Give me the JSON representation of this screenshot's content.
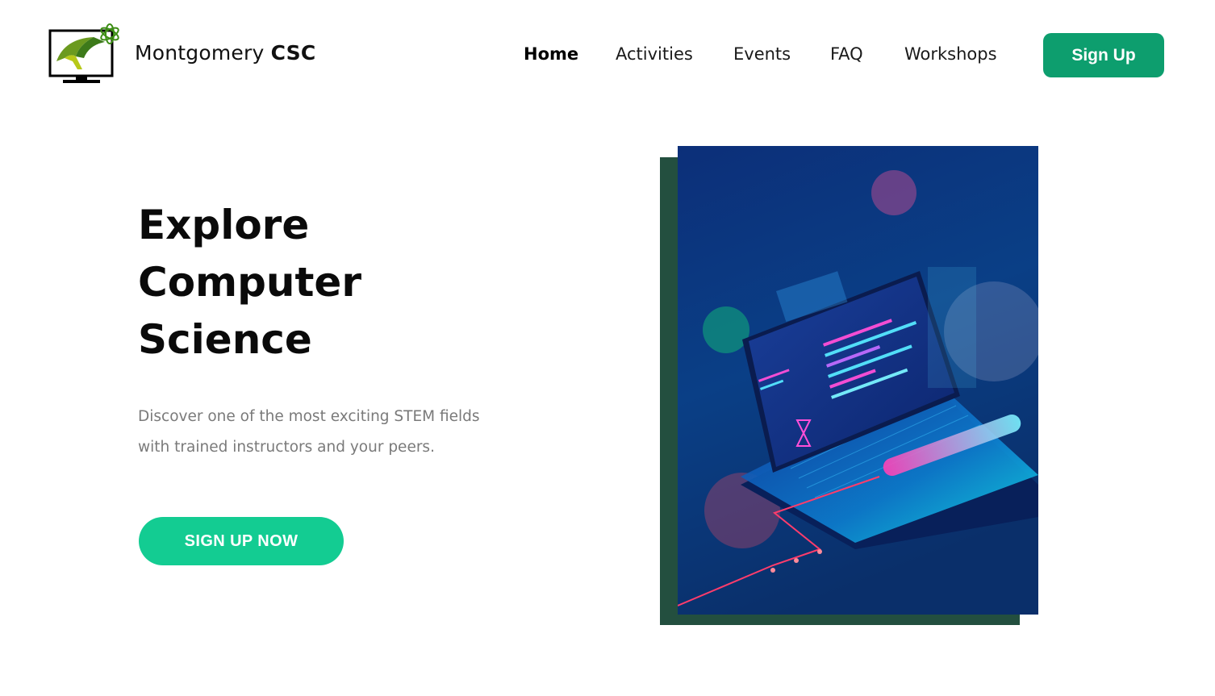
{
  "header": {
    "brand_prefix": "Montgomery ",
    "brand_strong": "CSC",
    "nav": [
      "Home",
      "Activities",
      "Events",
      "FAQ",
      "Workshops"
    ],
    "active_nav": "Home",
    "signup_label": "Sign Up"
  },
  "hero": {
    "title_lines": [
      "Explore",
      "Computer",
      "Science"
    ],
    "subtitle_line1": "Discover one of the most exciting STEM fields",
    "subtitle_line2": "with trained instructors and your peers.",
    "cta_label": "SIGN UP NOW"
  },
  "colors": {
    "signup_button": "#0d9e6e",
    "cta_button": "#13cc92",
    "image_backdrop": "#234f3f"
  },
  "icons": {
    "logo": "monitor-with-wildcat-logo-icon"
  }
}
